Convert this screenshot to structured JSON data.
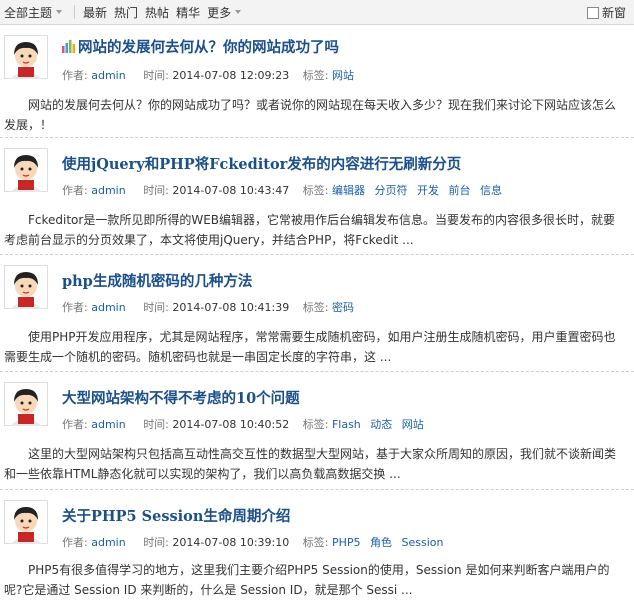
{
  "topbar": {
    "all_topics": "全部主题",
    "tabs": [
      "最新",
      "热门",
      "热帖",
      "精华"
    ],
    "more": "更多",
    "new_window": "新窗"
  },
  "labels": {
    "author": "作者:",
    "time": "时间:",
    "tags": "标签:"
  },
  "posts": [
    {
      "title": "网站的发展何去何从？你的网站成功了吗",
      "author": "admin",
      "time": "2014-07-08 12:09:23",
      "tags": [
        "网站"
      ],
      "summary": "网站的发展何去何从？你的网站成功了吗？或者说你的网站现在每天收入多少？现在我们来讨论下网站应该怎么发展，！"
    },
    {
      "title": "使用jQuery和PHP将Fckeditor发布的内容进行无刷新分页",
      "author": "admin",
      "time": "2014-07-08 10:43:47",
      "tags": [
        "编辑器",
        "分页符",
        "开发",
        "前台",
        "信息"
      ],
      "summary": "Fckeditor是一款所见即所得的WEB编辑器，它常被用作后台编辑发布信息。当要发布的内容很多很长时，就要考虑前台显示的分页效果了，本文将使用jQuery，并结合PHP，将Fckedit ..."
    },
    {
      "title": "php生成随机密码的几种方法",
      "author": "admin",
      "time": "2014-07-08 10:41:39",
      "tags": [
        "密码"
      ],
      "summary": "使用PHP开发应用程序，尤其是网站程序，常常需要生成随机密码，如用户注册生成随机密码，用户重置密码也需要生成一个随机的密码。随机密码也就是一串固定长度的字符串，这 ..."
    },
    {
      "title": "大型网站架构不得不考虑的10个问题",
      "author": "admin",
      "time": "2014-07-08 10:40:52",
      "tags": [
        "Flash",
        "动态",
        "网站"
      ],
      "summary": "这里的大型网站架构只包括高互动性高交互性的数据型大型网站，基于大家众所周知的原因，我们就不谈新闻类和一些依靠HTML静态化就可以实现的架构了，我们以高负载高数据交换 ..."
    },
    {
      "title": "关于PHP5 Session生命周期介绍",
      "author": "admin",
      "time": "2014-07-08 10:39:10",
      "tags": [
        "PHP5",
        "角色",
        "Session"
      ],
      "summary": "PHP5有很多值得学习的地方，这里我们主要介绍PHP5 Session的使用，Session 是如何来判断客户端用户的呢?它是通过 Session ID 来判断的，什么是 Session ID，就是那个 Sessi ..."
    }
  ]
}
